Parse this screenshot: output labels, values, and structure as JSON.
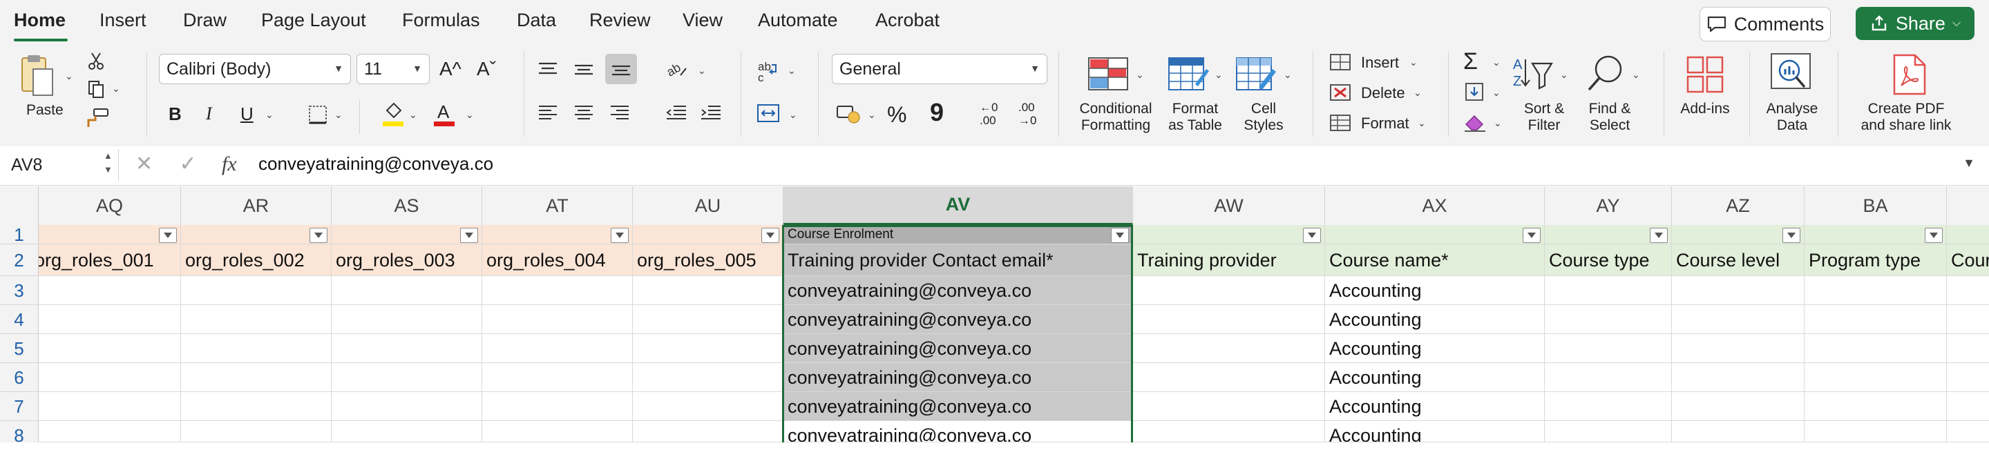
{
  "tabs": [
    "Home",
    "Insert",
    "Draw",
    "Page Layout",
    "Formulas",
    "Data",
    "Review",
    "View",
    "Automate",
    "Acrobat"
  ],
  "active_tab": "Home",
  "header_buttons": {
    "comments": "Comments",
    "share": "Share"
  },
  "ribbon": {
    "clipboard": {
      "paste": "Paste"
    },
    "font": {
      "family": "Calibri (Body)",
      "size": "11",
      "grow": "A^",
      "shrink": "Aˇ",
      "bold": "B",
      "italic": "I",
      "underline": "U",
      "font_color_letter": "A"
    },
    "number": {
      "format": "General",
      "percent": "%",
      "comma": "9",
      "inc_decimal_top": "←0",
      "inc_decimal_bottom": ".00",
      "dec_decimal_top": ".00",
      "dec_decimal_bottom": "→0"
    },
    "styles": {
      "conditional_formatting": [
        "Conditional",
        "Formatting"
      ],
      "format_as_table": [
        "Format",
        "as Table"
      ],
      "cell_styles": [
        "Cell",
        "Styles"
      ]
    },
    "cells": {
      "insert": "Insert",
      "delete": "Delete",
      "format": "Format"
    },
    "editing": {
      "sum": "Σ",
      "sort_filter": [
        "Sort &",
        "Filter"
      ],
      "find_select": [
        "Find &",
        "Select"
      ]
    },
    "addins": "Add-ins",
    "analyse_data": [
      "Analyse",
      "Data"
    ],
    "create_pdf": [
      "Create PDF",
      "and share link"
    ]
  },
  "formula_bar": {
    "name_box": "AV8",
    "fx": "fx",
    "formula": "conveyatraining@conveya.co"
  },
  "grid": {
    "columns": [
      "AQ",
      "AR",
      "AS",
      "AT",
      "AU",
      "AV",
      "AW",
      "AX",
      "AY",
      "AZ",
      "BA"
    ],
    "selected_column": "AV",
    "rows": [
      "1",
      "2",
      "3",
      "4",
      "5",
      "6",
      "7",
      "8"
    ],
    "row1": {
      "AV": "Course Enrolment"
    },
    "row2": [
      "org_roles_001",
      "org_roles_002",
      "org_roles_003",
      "org_roles_004",
      "org_roles_005",
      "Training provider Contact email*",
      "Training provider",
      "Course name*",
      "Course type",
      "Course level",
      "Program type",
      "Cour"
    ],
    "av_values": [
      "conveyatraining@conveya.co",
      "conveyatraining@conveya.co",
      "conveyatraining@conveya.co",
      "conveyatraining@conveya.co",
      "conveyatraining@conveya.co",
      "conveyatraining@conveya.co"
    ],
    "ax_values": [
      "Accounting",
      "Accounting",
      "Accounting",
      "Accounting",
      "Accounting",
      "Accounting"
    ],
    "colors": {
      "orange_header": "#fbe5d6",
      "green_header": "#e2efda",
      "selected_fill": "#c9c9c9",
      "selected_header": "#b0b0b0",
      "accent": "#1e6b3a"
    }
  }
}
